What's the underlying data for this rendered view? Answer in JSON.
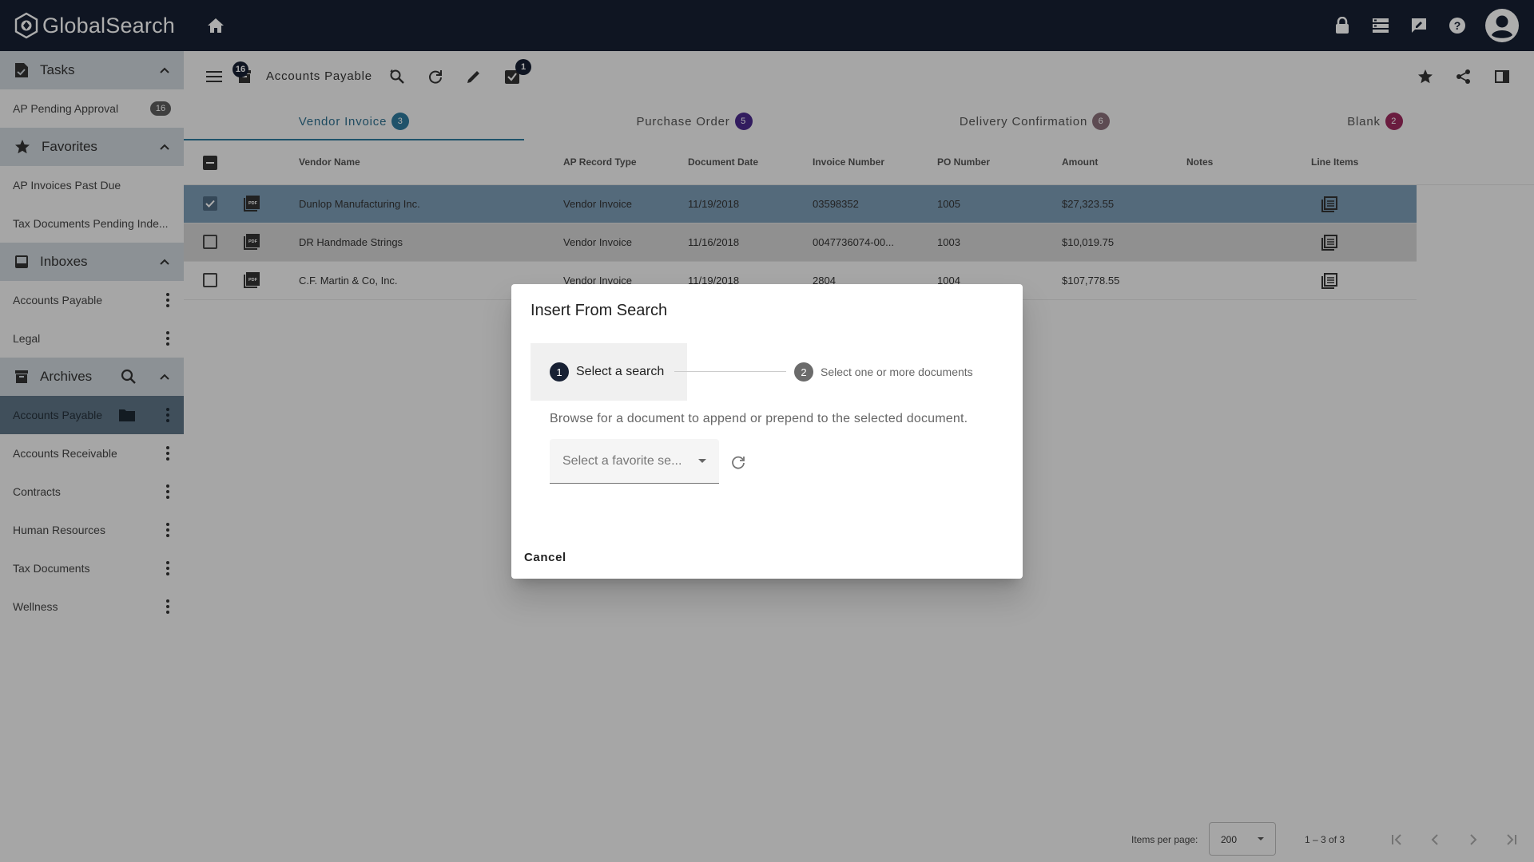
{
  "app": {
    "name": "GlobalSearch"
  },
  "sidebar": {
    "tasks": {
      "title": "Tasks",
      "items": [
        {
          "label": "AP Pending Approval",
          "count": "16"
        }
      ]
    },
    "favorites": {
      "title": "Favorites",
      "items": [
        {
          "label": "AP Invoices Past Due"
        },
        {
          "label": "Tax Documents Pending Inde..."
        }
      ]
    },
    "inboxes": {
      "title": "Inboxes",
      "items": [
        {
          "label": "Accounts Payable"
        },
        {
          "label": "Legal"
        }
      ]
    },
    "archives": {
      "title": "Archives",
      "items": [
        {
          "label": "Accounts Payable"
        },
        {
          "label": "Accounts Receivable"
        },
        {
          "label": "Contracts"
        },
        {
          "label": "Human Resources"
        },
        {
          "label": "Tax Documents"
        },
        {
          "label": "Wellness"
        }
      ]
    }
  },
  "toolbar": {
    "title": "Accounts Payable",
    "count_badge": "16",
    "task_badge": "1"
  },
  "tabs": [
    {
      "label": "Vendor Invoice",
      "count": "3",
      "color": "#2f7a9c"
    },
    {
      "label": "Purchase Order",
      "count": "5",
      "color": "#4a2a8c"
    },
    {
      "label": "Delivery Confirmation",
      "count": "6",
      "color": "#8a6f7a"
    },
    {
      "label": "Blank",
      "count": "2",
      "color": "#9c2a5e"
    }
  ],
  "table": {
    "headers": [
      "Vendor Name",
      "AP Record Type",
      "Document Date",
      "Invoice Number",
      "PO Number",
      "Amount",
      "Notes",
      "Line Items"
    ],
    "rows": [
      {
        "vendor": "Dunlop Manufacturing Inc.",
        "type": "Vendor Invoice",
        "date": "11/19/2018",
        "invoice": "03598352",
        "po": "1005",
        "amount": "$27,323.55",
        "selected": true
      },
      {
        "vendor": "DR Handmade Strings",
        "type": "Vendor Invoice",
        "date": "11/16/2018",
        "invoice": "0047736074-00...",
        "po": "1003",
        "amount": "$10,019.75",
        "selected": false
      },
      {
        "vendor": "C.F. Martin & Co, Inc.",
        "type": "Vendor Invoice",
        "date": "11/19/2018",
        "invoice": "2804",
        "po": "1004",
        "amount": "$107,778.55",
        "selected": false
      }
    ]
  },
  "paginator": {
    "items_per_page_label": "Items per page:",
    "page_size": "200",
    "range": "1 – 3 of 3"
  },
  "dialog": {
    "title": "Insert From Search",
    "step1": {
      "num": "1",
      "label": "Select a search"
    },
    "step2": {
      "num": "2",
      "label": "Select one or more documents"
    },
    "description": "Browse for a document to append or prepend to the selected document.",
    "select_placeholder": "Select a favorite se...",
    "cancel_label": "Cancel"
  },
  "colors": {
    "topbar": "#172033",
    "sidebar_header": "#cfd6dc",
    "active_item": "#5f7586",
    "selected_row": "#7d9cb5"
  }
}
